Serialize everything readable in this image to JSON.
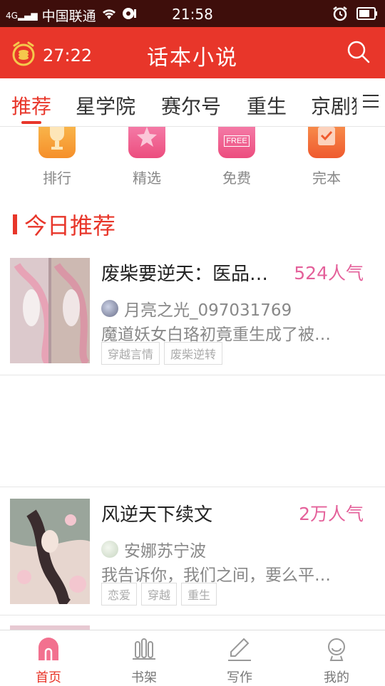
{
  "status_bar": {
    "carrier": "中国联通",
    "network": "4G",
    "time": "21:58"
  },
  "app_bar": {
    "timer": "27:22",
    "title": "话本小说"
  },
  "tabs": [
    {
      "label": "推荐",
      "active": true
    },
    {
      "label": "星学院"
    },
    {
      "label": "赛尔号"
    },
    {
      "label": "重生"
    },
    {
      "label": "京剧猫"
    }
  ],
  "categories": [
    {
      "label": "排行",
      "icon": "trophy-icon",
      "color": "#f7a33a"
    },
    {
      "label": "精选",
      "icon": "star-icon",
      "color": "#f05a8a"
    },
    {
      "label": "免费",
      "icon": "free-icon",
      "badge": "FREE",
      "color": "#f05a8a"
    },
    {
      "label": "完本",
      "icon": "check-icon",
      "color": "#f06f3a"
    }
  ],
  "section": {
    "title": "今日推荐"
  },
  "books": [
    {
      "title": "废柴要逆天：医品…",
      "popularity": "524人气",
      "author": "月亮之光_097031769",
      "description": "魔道妖女白珞初竟重生成了被…",
      "tags": [
        "穿越言情",
        "废柴逆转"
      ]
    },
    {
      "title": "风逆天下续文",
      "popularity": "2万人气",
      "author": "安娜苏宁波",
      "description": "我告诉你，我们之间，要么平…",
      "tags": [
        "恋爱",
        "穿越",
        "重生"
      ]
    }
  ],
  "bottom_nav": [
    {
      "label": "首页",
      "icon": "home-icon",
      "active": true
    },
    {
      "label": "书架",
      "icon": "bookshelf-icon"
    },
    {
      "label": "写作",
      "icon": "pen-icon"
    },
    {
      "label": "我的",
      "icon": "profile-icon"
    }
  ],
  "colors": {
    "primary": "#e8362a",
    "status_bar": "#3e0e0b",
    "popularity": "#e4609a"
  }
}
